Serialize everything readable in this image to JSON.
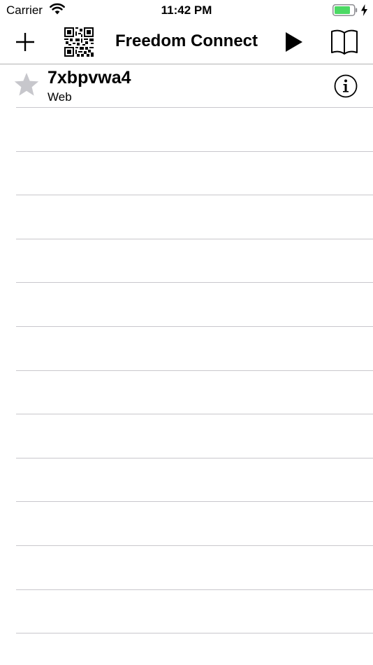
{
  "status_bar": {
    "carrier": "Carrier",
    "time": "11:42 PM",
    "wifi_icon": "wifi-icon",
    "battery_icon": "battery-icon",
    "charging_icon": "lightning-icon",
    "battery_fill_color": "#4cd964"
  },
  "nav_bar": {
    "title": "Freedom Connect",
    "buttons": {
      "add": "plus-icon",
      "scan": "qr-code-icon",
      "play": "play-icon",
      "guide": "book-icon"
    }
  },
  "list": {
    "items": [
      {
        "title": "7xbpvwa4",
        "subtitle": "Web",
        "favorite_icon": "star-icon",
        "info_icon": "info-icon",
        "star_color": "#c7c7cc"
      }
    ]
  }
}
